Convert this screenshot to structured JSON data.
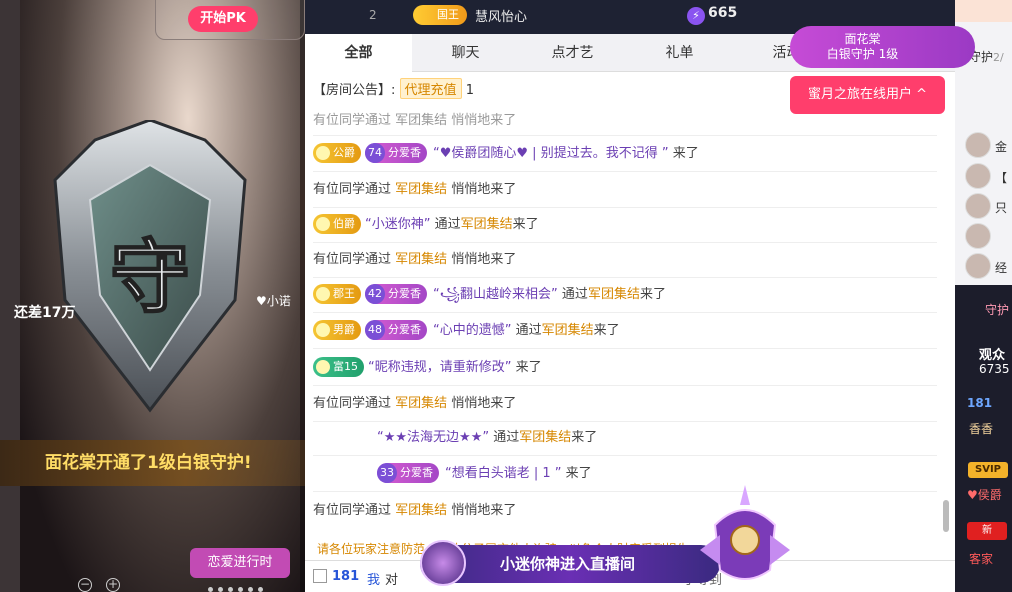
{
  "left": {
    "pk_label": "开始PK",
    "shield_char": "守",
    "streamer_tag": "♥小诺",
    "gap_text": "还差17万",
    "banner_text": "面花棠开通了1级白银守护!",
    "love_btn": "恋爱进行时"
  },
  "header": {
    "rank_num": "2",
    "king_badge": "国王",
    "king_name": "慧风怡心",
    "energy": "665"
  },
  "tabs": [
    "全部",
    "聊天",
    "点才艺",
    "礼单",
    "活动"
  ],
  "notice": {
    "prefix": "【房间公告】:",
    "chip": "代理充值",
    "suffix": "1"
  },
  "chat": {
    "msg1_cut": "有位同学通过 军团集结 悄悄地来了",
    "m2_rank": "公爵",
    "m2_lv": "74",
    "m2_fans": "分爱香",
    "m2_quote": "“♥侯爵团随心♥ | 别提过去。我不记得 ”",
    "m2_tail": "来了",
    "m3_a": "有位同学通过",
    "m3_b": "军团集结",
    "m3_c": "悄悄地来了",
    "m4_rank": "伯爵",
    "m4_quote": "“小迷你神”",
    "m4_via": "通过",
    "m4_hl": "军团集结",
    "m4_tail": "来了",
    "m5_a": "有位同学通过",
    "m5_b": "军团集结",
    "m5_c": "悄悄地来了",
    "m6_rank": "郡王",
    "m6_lv": "42",
    "m6_fans": "分爱香",
    "m6_quote": "“꧁翻山越岭来相会”",
    "m6_via": "通过",
    "m6_hl": "军团集结",
    "m6_tail": "来了",
    "m7_rank": "男爵",
    "m7_lv": "48",
    "m7_fans": "分爱香",
    "m7_quote": "“心中的遗憾”",
    "m7_via": "通过",
    "m7_hl": "军团集结",
    "m7_tail": "来了",
    "m8_rank": "富15",
    "m8_quote": "“昵称违规，请重新修改”",
    "m8_tail": "来了",
    "m9_a": "有位同学通过",
    "m9_b": "军团集结",
    "m9_c": "悄悄地来了",
    "m10_quote": "“★★法海无边★★”",
    "m10_via": "通过",
    "m10_hl": "军团集结",
    "m10_tail": "来了",
    "m11_lv": "33",
    "m11_fans": "分爱香",
    "m11_quote": "“想看白头谐老 | 1 ”",
    "m11_tail": "来了",
    "m12_a": "有位同学通过",
    "m12_b": "军团集结",
    "m12_c": "悄悄地来了"
  },
  "rules_text": "请各位玩家注意防范，不法分子冒充他人诈骗，以免个人财产受到损失",
  "bottom": {
    "uid": "181",
    "me": "我",
    "to": "对",
    "etc": "于等到"
  },
  "entry_text": "小迷你神进入直播间",
  "guard_pill": {
    "name": "面花棠",
    "sub": "白银守护",
    "level": "1级"
  },
  "honey_btn": "蜜月之旅在线用户 ^",
  "right": {
    "guard_tab": "守护",
    "guard_count": "2/",
    "names": [
      "金",
      "【",
      "只",
      "",
      "经"
    ],
    "guard_link": "守护",
    "viewers": "观众",
    "count": "6735",
    "uid": "181",
    "xiang": "香香",
    "svip": "SVIP",
    "houjue": "♥侯爵",
    "new": "新",
    "kejia": "客家"
  },
  "colors": {
    "accent": "#ff3e6c",
    "purple": "#9b3ac4",
    "gold": "#d68700"
  }
}
